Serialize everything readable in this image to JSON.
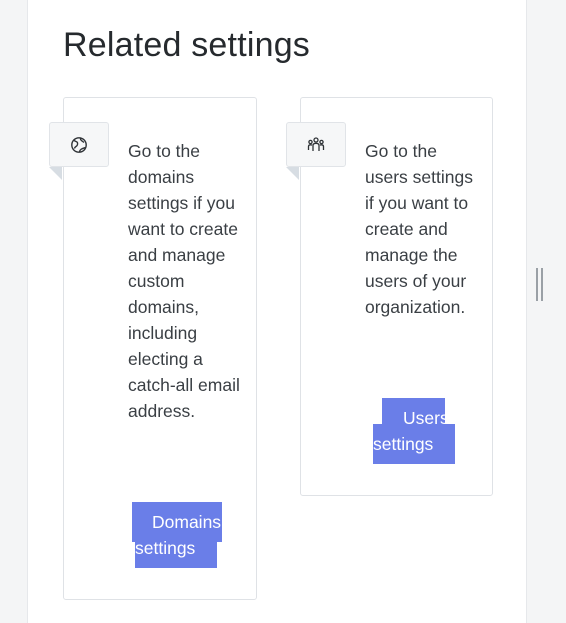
{
  "section": {
    "title": "Related settings"
  },
  "cards": {
    "domains": {
      "icon": "globe-icon",
      "description": "Go to the domains settings if you want to create and manage custom domains, including electing a catch-all email address.",
      "button_line1": "Domains",
      "button_line2": "settings"
    },
    "users": {
      "icon": "users-group-icon",
      "description": "Go to the users settings if you want to create and manage the users of your organization.",
      "button_line1": "Users",
      "button_line2": "settings"
    }
  },
  "colors": {
    "button": "#6a7ee8",
    "heading": "#262a2e",
    "text": "#3a3f44"
  }
}
